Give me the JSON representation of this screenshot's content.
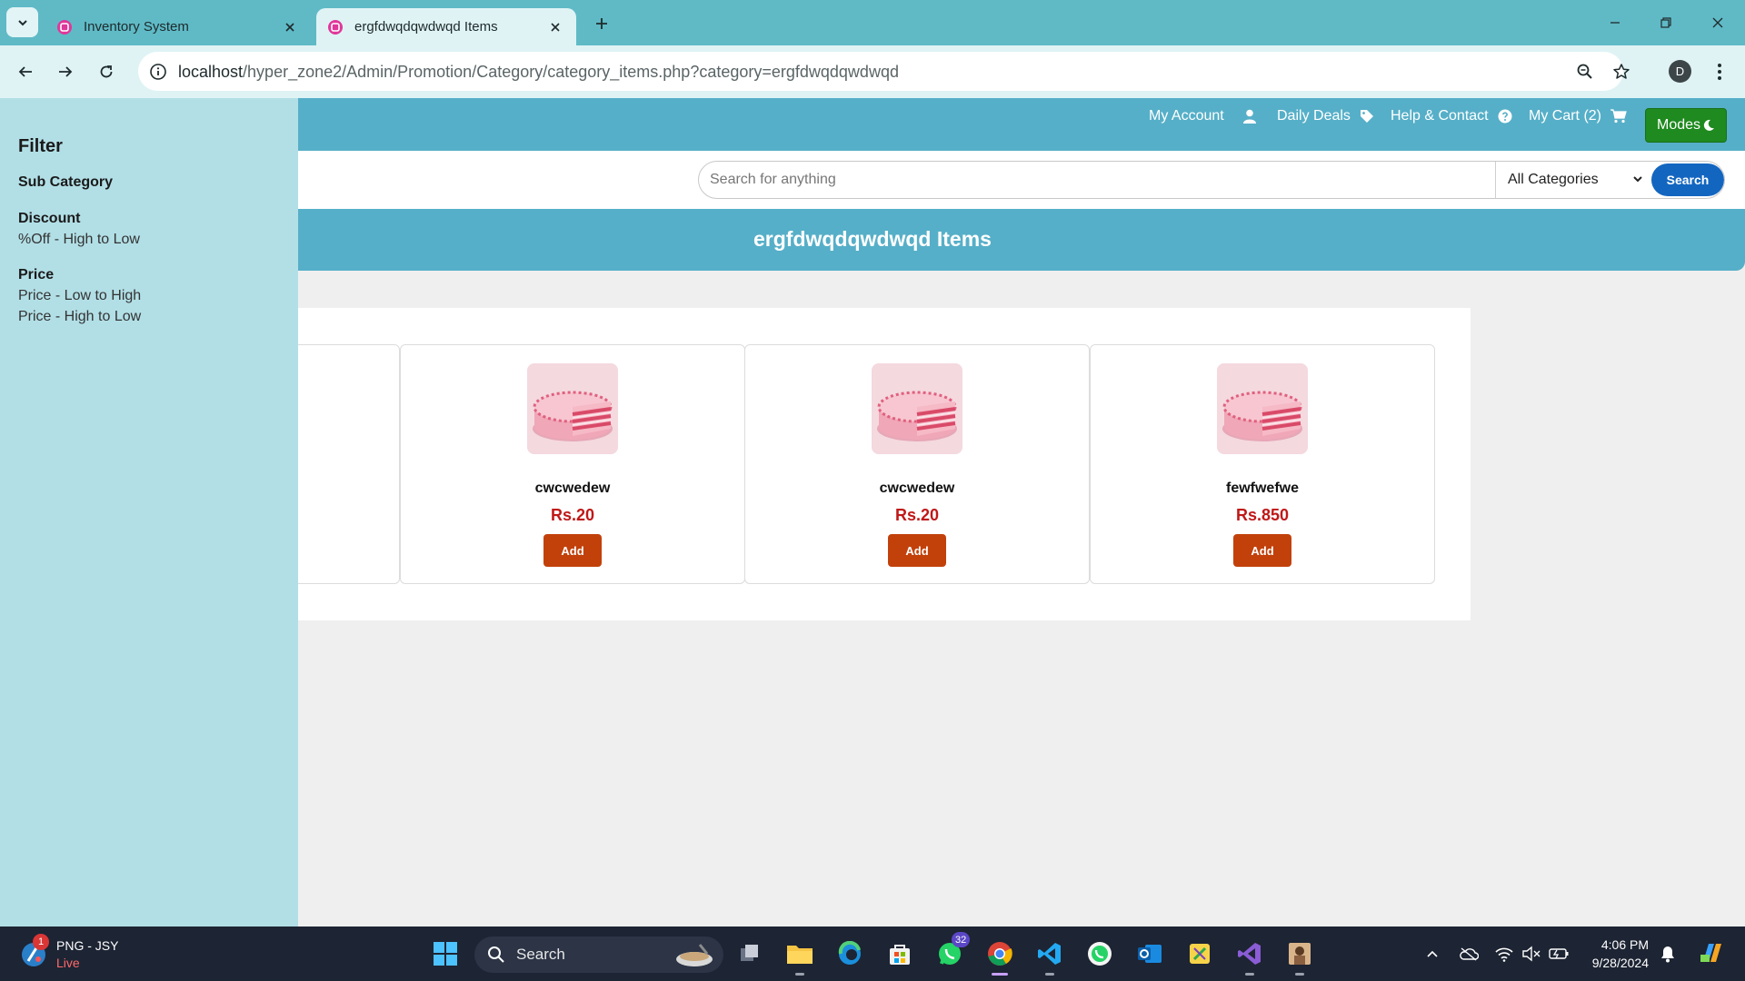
{
  "browser": {
    "tabs": [
      {
        "title": "Inventory System",
        "active": false
      },
      {
        "title": "ergfdwqdqwdwqd Items",
        "active": true
      }
    ],
    "url_host": "localhost",
    "url_path": "/hyper_zone2/Admin/Promotion/Category/category_items.php?category=ergfdwqdqwdwqd",
    "profile_initial": "D"
  },
  "header": {
    "nav": [
      {
        "label": "My Account",
        "icon": "user-icon"
      },
      {
        "label": "Daily Deals",
        "icon": "tag-icon"
      },
      {
        "label": "Help & Contact",
        "icon": "question-circle-icon"
      },
      {
        "label": "My Cart (2)",
        "icon": "cart-icon"
      }
    ],
    "modes_label": "Modes"
  },
  "search": {
    "placeholder": "Search for anything",
    "category_selected": "All Categories",
    "button_label": "Search"
  },
  "page_title": "ergfdwqdqwdwqd Items",
  "filter": {
    "title": "Filter",
    "groups": [
      {
        "heading": "Sub Category",
        "options": []
      },
      {
        "heading": "Discount",
        "options": [
          "%Off - High to Low"
        ]
      },
      {
        "heading": "Price",
        "options": [
          "Price - Low to High",
          "Price - High to Low"
        ]
      }
    ]
  },
  "products": [
    {
      "name": "cwcwedew",
      "price": "Rs.20",
      "button": "Add"
    },
    {
      "name": "cwcwedew",
      "price": "Rs.20",
      "button": "Add"
    },
    {
      "name": "fewfwefwe",
      "price": "Rs.850",
      "button": "Add"
    }
  ],
  "taskbar": {
    "weather_title": "PNG - JSY",
    "weather_sub": "Live",
    "weather_badge": "1",
    "search_label": "Search",
    "whatsapp_badge": "32",
    "time": "4:06 PM",
    "date": "9/28/2024"
  },
  "colors": {
    "tabbar": "#5fbac6",
    "header": "#56afc8",
    "filter_panel": "#b2dfe6",
    "modes_button": "#1f8a1f",
    "search_button": "#1366c0",
    "add_button": "#c2410b",
    "price": "#c01818"
  }
}
